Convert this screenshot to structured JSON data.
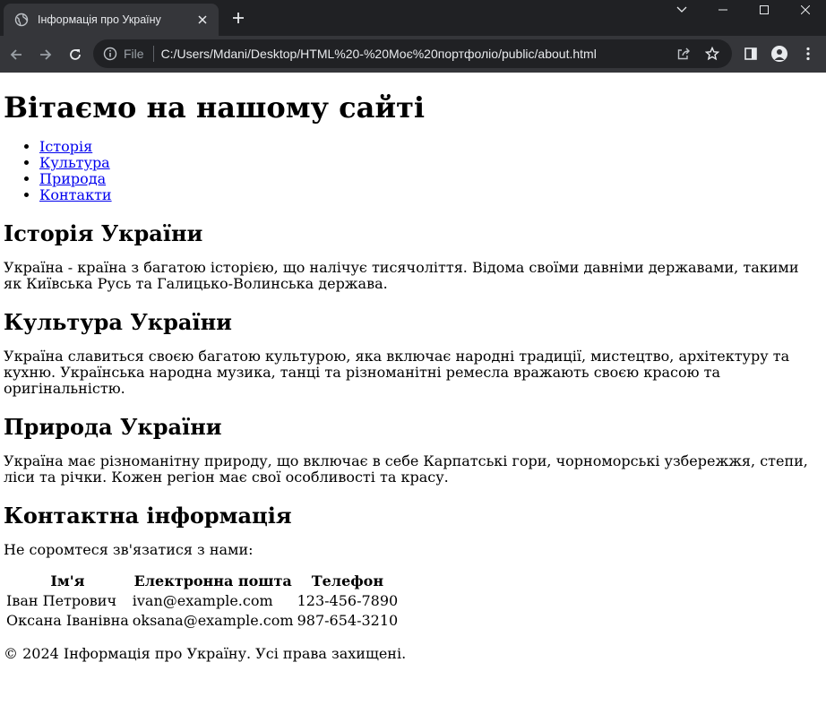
{
  "browser": {
    "tab_title": "Інформація про Україну",
    "url_scheme": "File",
    "url": "C:/Users/Mdani/Desktop/HTML%20-%20Моє%20портфоліо/public/about.html"
  },
  "page": {
    "heading": "Вітаємо на нашому сайті",
    "nav": [
      {
        "label": "Історія"
      },
      {
        "label": "Культура"
      },
      {
        "label": "Природа"
      },
      {
        "label": "Контакти"
      }
    ],
    "sections": {
      "history": {
        "title": "Історія України",
        "text": "Україна - країна з багатою історією, що налічує тисячоліття. Відома своїми давніми державами, такими як Київська Русь та Галицько-Волинська держава."
      },
      "culture": {
        "title": "Культура України",
        "text": "Україна славиться своєю багатою культурою, яка включає народні традиції, мистецтво, архітектуру та кухню. Українська народна музика, танці та різноманітні ремесла вражають своєю красою та оригінальністю."
      },
      "nature": {
        "title": "Природа України",
        "text": "Україна має різноманітну природу, що включає в себе Карпатські гори, чорноморські узбережжя, степи, ліси та річки. Кожен регіон має свої особливості та красу."
      },
      "contacts": {
        "title": "Контактна інформація",
        "intro": "Не соромтеся зв'язатися з нами:",
        "headers": [
          "Ім'я",
          "Електронна пошта",
          "Телефон"
        ],
        "rows": [
          [
            "Іван Петрович",
            "ivan@example.com",
            "123-456-7890"
          ],
          [
            "Оксана Іванівна",
            "oksana@example.com",
            "987-654-3210"
          ]
        ]
      }
    },
    "footer": "© 2024 Інформація про Україну. Усі права захищені."
  },
  "icons": {
    "favicon": "globe-icon",
    "close": "close-icon",
    "new_tab": "plus-icon",
    "back": "back-arrow-icon",
    "forward": "forward-arrow-icon",
    "reload": "reload-icon",
    "site_info": "info-icon",
    "share": "share-icon",
    "bookmark": "star-icon",
    "side_panel": "side-panel-icon",
    "profile": "profile-icon",
    "menu": "kebab-menu-icon"
  },
  "colors": {
    "chrome_dark": "#202124",
    "chrome_toolbar": "#35363a",
    "link": "#0000ee"
  }
}
